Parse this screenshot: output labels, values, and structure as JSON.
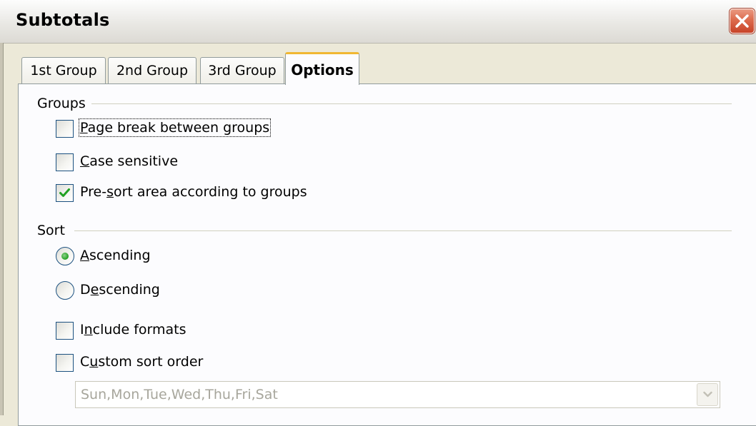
{
  "window": {
    "title": "Subtotals"
  },
  "tabs": [
    {
      "label": "1st Group",
      "active": false
    },
    {
      "label": "2nd Group",
      "active": false
    },
    {
      "label": "3rd Group",
      "active": false
    },
    {
      "label": "Options",
      "active": true
    }
  ],
  "groups": {
    "label": "Groups",
    "options": [
      {
        "pre": "",
        "accel": "P",
        "post": "age break between groups",
        "checked": false
      },
      {
        "pre": "",
        "accel": "C",
        "post": "ase sensitive",
        "checked": false
      },
      {
        "pre": "Pre-",
        "accel": "s",
        "post": "ort area according to groups",
        "checked": true
      }
    ]
  },
  "sort": {
    "label": "Sort",
    "radios": [
      {
        "pre": "",
        "accel": "A",
        "post": "scending",
        "selected": true
      },
      {
        "pre": "D",
        "accel": "e",
        "post": "scending",
        "selected": false
      }
    ],
    "checks": [
      {
        "pre": "I",
        "accel": "n",
        "post": "clude formats",
        "checked": false
      },
      {
        "pre": "C",
        "accel": "u",
        "post": "stom sort order",
        "checked": false
      }
    ],
    "custom_order_value": "Sun,Mon,Tue,Wed,Thu,Fri,Sat"
  },
  "colors": {
    "tab_accent": "#f0b732",
    "check_mark": "#21a121",
    "close_button": "#dd6b4d"
  }
}
